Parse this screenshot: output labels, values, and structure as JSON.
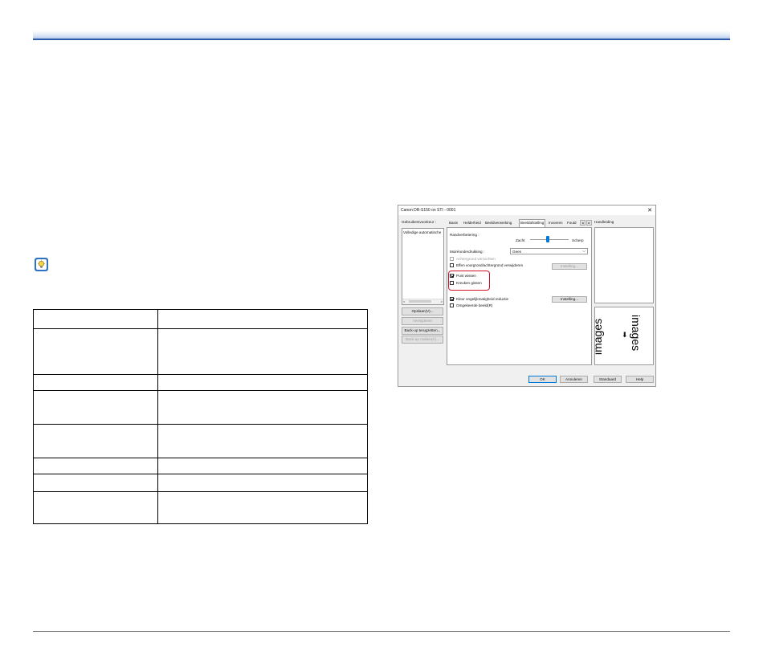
{
  "table": {
    "rows": [
      [
        "",
        ""
      ],
      [
        "",
        ""
      ],
      [
        "",
        ""
      ],
      [
        "",
        ""
      ],
      [
        "",
        ""
      ],
      [
        "",
        ""
      ],
      [
        "",
        ""
      ],
      [
        "",
        ""
      ]
    ]
  },
  "dialog": {
    "title": "Canon DR-S150 on STI - 0001",
    "close_glyph": "✕",
    "user_settings_label": "Gebruikersvoorkeur :",
    "user_list_item": "Volledige automatische",
    "save_button": "Opslaan(V)...",
    "delete_button": "Verwijderen",
    "restore_backup_button": "Back-up terugzetten...",
    "create_backup_button": "Back-up maken(K)...",
    "tabs": [
      "Basis",
      "Helderheid",
      "Beeldverwerking",
      "Beeldafstelling",
      "Invoeren",
      "Foutd"
    ],
    "active_tab": "Beeldafstelling",
    "edge_emphasis_label": "Randverbetering :",
    "slider_left": "Zacht",
    "slider_right": "Scherp",
    "slider_value": 0.45,
    "moire_label": "Moiréonderdrukking :",
    "moire_value": "Geen",
    "bg_smoothing_label": "Achtergrond verzachten",
    "remove_shadow_label": "Effen voorgrond/achtergrond verwijderen",
    "settings_button": "Instelling...",
    "punch_label": "Punt wissen",
    "notch_label": "Kreuken gissen",
    "rollup_label": "Kleur ongelijkmatigheid reductie",
    "settings_button_2": "Instelling...",
    "inverted_label": "Omgekeerde beeld(R)",
    "manual_label": "Handleiding",
    "preview_text": "images",
    "ok_button": "OK",
    "cancel_button": "Annuleren",
    "default_button": "Standaard",
    "help_button": "Help",
    "colors": {
      "highlight": "#d0122e",
      "slider_thumb": "#0078d7",
      "tip_icon": "#2f72c4"
    }
  }
}
